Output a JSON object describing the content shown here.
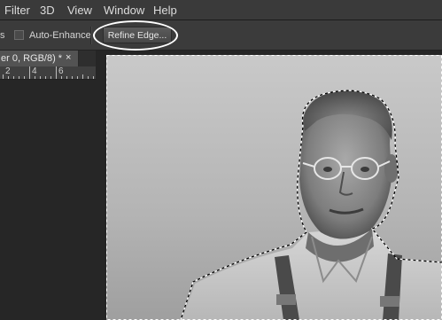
{
  "menu": {
    "items": [
      "Filter",
      "3D",
      "View",
      "Window",
      "Help"
    ]
  },
  "options_bar": {
    "clipped_label": "s",
    "auto_enhance_label": "Auto-Enhance",
    "auto_enhance_checked": false,
    "refine_edge_label": "Refine Edge..."
  },
  "document": {
    "tab_title": "er 0, RGB/8) *",
    "close_glyph": "×"
  },
  "ruler": {
    "labels": [
      "2",
      "4",
      "6"
    ]
  },
  "icons": {
    "close": "close-icon",
    "checkbox": "checkbox-icon"
  },
  "colors": {
    "highlight": "#ffffff",
    "marching_ants": "#ffffff",
    "panel_bg": "#3a3a3a"
  }
}
